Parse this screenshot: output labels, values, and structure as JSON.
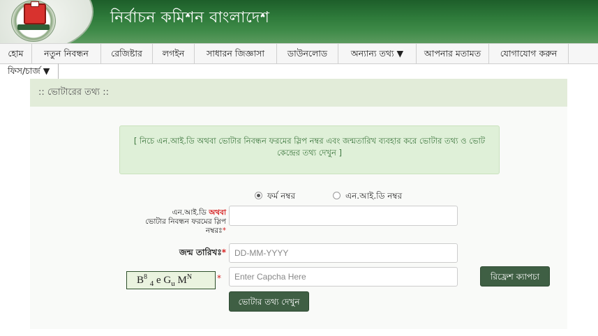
{
  "header": {
    "site_title": "নির্বাচন কমিশন বাংলাদেশ",
    "logo_text": "ব্যালটবাক্স"
  },
  "nav": {
    "items": [
      "হোম",
      "নতুন নিবন্ধন",
      "রেজিষ্টার",
      "লগইন",
      "সাধারন জিজ্ঞাসা",
      "ডাউনলোড",
      "অন্যান্য তথ্য ▼",
      "আপনার মতামত",
      "যোগাযোগ করুন"
    ],
    "row2": "ফিস/চার্জ ▼"
  },
  "panel": {
    "title": ":: ভোটারের তথ্য ::",
    "info": "[ নিচে এন.আই.ডি অথবা ভোটার নিবন্ধন ফরমের স্লিপ নম্বর এবং জন্মতারিখ ব্যবহার করে ভোটার তথ্য ও ভোট কেন্দ্রের তথ্য দেখুন ]"
  },
  "form": {
    "radio_form_number": "ফর্ম নম্বর",
    "radio_nid_number": "এন.আই.ডি নম্বর",
    "radio_selected": "ফর্ম নম্বর",
    "id_label_part1": "এন.আই.ডি",
    "id_label_or": "অথবা",
    "id_label_part2": "ভোটার নিবন্ধন ফরমের স্লিপ",
    "id_label_part3": "নম্বরঃ",
    "id_value": "",
    "dob_label": "জন্ম তারিখঃ",
    "dob_placeholder": "DD-MM-YYYY",
    "captcha_text": "B8 4 e Gu MN",
    "captcha_placeholder": "Enter Capcha Here",
    "refresh_button": "রিফ্রেশ ক্যাপচা",
    "submit_button": "ভোটার তথ্য দেখুন",
    "required_mark": "*"
  }
}
